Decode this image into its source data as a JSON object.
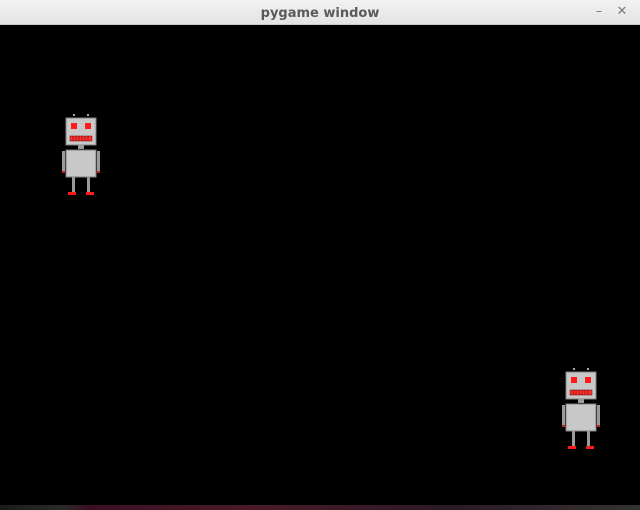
{
  "window": {
    "title": "pygame window",
    "minimize_symbol": "–",
    "close_symbol": "✕"
  },
  "canvas": {
    "background": "#000000",
    "sprites": [
      {
        "name": "robot",
        "color_body": "#c8c8c8",
        "color_eyes": "#ff0000",
        "color_feet": "#ff0000"
      },
      {
        "name": "robot",
        "color_body": "#c8c8c8",
        "color_eyes": "#ff0000",
        "color_feet": "#ff0000"
      }
    ]
  }
}
